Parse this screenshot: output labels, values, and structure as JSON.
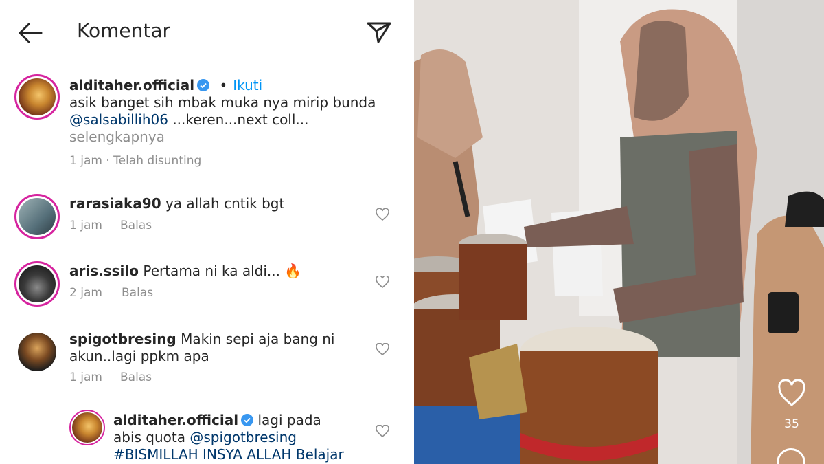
{
  "header": {
    "title": "Komentar"
  },
  "caption": {
    "username": "alditaher.official",
    "follow_label": "Ikuti",
    "text_before": "asik banget sih mbak muka nya mirip bunda ",
    "mention": "@salsabillih06",
    "text_after": " ...keren...next coll...",
    "more_label": "selengkapnya",
    "meta": "1 jam · Telah disunting"
  },
  "comments": [
    {
      "username": "rarasiaka90",
      "text": "ya allah cntik bgt",
      "time": "1 jam",
      "reply_label": "Balas"
    },
    {
      "username": "aris.ssilo",
      "text": "Pertama ni ka aldi... 🔥",
      "time": "2 jam",
      "reply_label": "Balas"
    },
    {
      "username": "spigotbresing",
      "text": "Makin sepi aja bang ni akun..lagi ppkm apa",
      "time": "1 jam",
      "reply_label": "Balas"
    }
  ],
  "reply": {
    "username": "alditaher.official",
    "text_before": "lagi pada abis quota ",
    "mention": "@spigotbresing",
    "hashtag": "#BISMILLAH INSYA ALLAH Belajar BACA A"
  },
  "video": {
    "like_count": "35"
  },
  "colors": {
    "accent_blue": "#0095f6",
    "link_blue": "#00376b",
    "muted": "#8e8e8e",
    "story_ring": "#d6249f"
  }
}
